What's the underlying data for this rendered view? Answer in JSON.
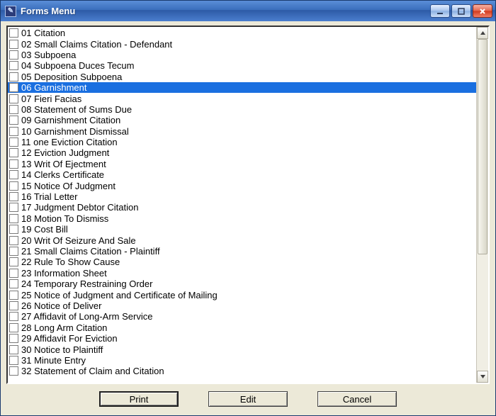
{
  "window": {
    "title": "Forms Menu"
  },
  "list": {
    "selected_index": 5,
    "items": [
      {
        "label": "01 Citation"
      },
      {
        "label": "02 Small Claims Citation - Defendant"
      },
      {
        "label": "03 Subpoena"
      },
      {
        "label": "04 Subpoena Duces Tecum"
      },
      {
        "label": "05 Deposition Subpoena"
      },
      {
        "label": "06 Garnishment"
      },
      {
        "label": "07 Fieri Facias"
      },
      {
        "label": "08 Statement of Sums Due"
      },
      {
        "label": "09 Garnishment Citation"
      },
      {
        "label": "10 Garnishment Dismissal"
      },
      {
        "label": "11 one Eviction Citation"
      },
      {
        "label": "12 Eviction Judgment"
      },
      {
        "label": "13 Writ Of Ejectment"
      },
      {
        "label": "14 Clerks Certificate"
      },
      {
        "label": "15 Notice Of Judgment"
      },
      {
        "label": "16 Trial Letter"
      },
      {
        "label": "17 Judgment Debtor Citation"
      },
      {
        "label": "18 Motion To Dismiss"
      },
      {
        "label": "19 Cost Bill"
      },
      {
        "label": "20 Writ Of Seizure And Sale"
      },
      {
        "label": "21 Small Claims Citation - Plaintiff"
      },
      {
        "label": "22 Rule To Show Cause"
      },
      {
        "label": "23 Information Sheet"
      },
      {
        "label": "24 Temporary Restraining Order"
      },
      {
        "label": "25 Notice of Judgment and Certificate of Mailing"
      },
      {
        "label": "26 Notice of Deliver"
      },
      {
        "label": "27 Affidavit of Long-Arm Service"
      },
      {
        "label": "28 Long Arm Citation"
      },
      {
        "label": "29 Affidavit For Eviction"
      },
      {
        "label": "30 Notice to Plaintiff"
      },
      {
        "label": "31 Minute Entry"
      },
      {
        "label": "32 Statement of Claim and Citation"
      }
    ]
  },
  "buttons": {
    "print": "Print",
    "edit": "Edit",
    "cancel": "Cancel"
  }
}
